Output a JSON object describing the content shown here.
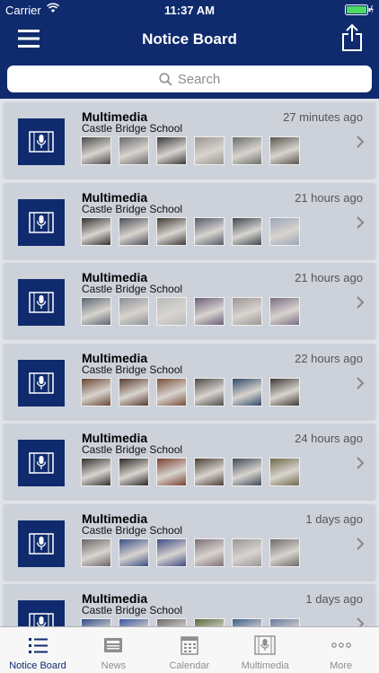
{
  "status": {
    "carrier": "Carrier",
    "time": "11:37 AM"
  },
  "nav": {
    "title": "Notice Board"
  },
  "search": {
    "placeholder": "Search"
  },
  "notices": [
    {
      "title": "Multimedia",
      "subtitle": "Castle Bridge School",
      "time": "27 minutes ago",
      "thumbs": [
        "#4a4a4a",
        "#6a6a6a",
        "#3a3a3a",
        "#9a9590",
        "#6b6f6a",
        "#5b554e"
      ]
    },
    {
      "title": "Multimedia",
      "subtitle": "Castle Bridge School",
      "time": "21 hours ago",
      "thumbs": [
        "#333030",
        "#4c4f5a",
        "#3f3a36",
        "#525a6b",
        "#3f4752",
        "#9aa5b8"
      ]
    },
    {
      "title": "Multimedia",
      "subtitle": "Castle Bridge School",
      "time": "21 hours ago",
      "thumbs": [
        "#5c6672",
        "#8b9096",
        "#b7bbb9",
        "#6a5f79",
        "#9c9694",
        "#7a6d84"
      ]
    },
    {
      "title": "Multimedia",
      "subtitle": "Castle Bridge School",
      "time": "22 hours ago",
      "thumbs": [
        "#6b4533",
        "#5a3a2e",
        "#7a4e3b",
        "#4e4a48",
        "#2f4a6a",
        "#403a37"
      ]
    },
    {
      "title": "Multimedia",
      "subtitle": "Castle Bridge School",
      "time": "24 hours ago",
      "thumbs": [
        "#33302c",
        "#2c2926",
        "#7a3f2f",
        "#4b3f35",
        "#3d4a57",
        "#6f6a49"
      ]
    },
    {
      "title": "Multimedia",
      "subtitle": "Castle Bridge School",
      "time": "1 days ago",
      "thumbs": [
        "#6a6565",
        "#3b4f88",
        "#3e4a86",
        "#7d6f78",
        "#9a9696",
        "#6e6c69"
      ]
    },
    {
      "title": "Multimedia",
      "subtitle": "Castle Bridge School",
      "time": "1 days ago",
      "thumbs": [
        "#2f4a8a",
        "#3a55a0",
        "#6a6a6a",
        "#5a6a3a",
        "#3b5f8a",
        "#6a7aa0"
      ]
    }
  ],
  "tabs": [
    {
      "label": "Notice Board",
      "icon": "list-icon",
      "active": true
    },
    {
      "label": "News",
      "icon": "newspaper-icon",
      "active": false
    },
    {
      "label": "Calendar",
      "icon": "calendar-icon",
      "active": false
    },
    {
      "label": "Multimedia",
      "icon": "multimedia-icon",
      "active": false
    },
    {
      "label": "More",
      "icon": "more-icon",
      "active": false
    }
  ],
  "colors": {
    "brand": "#0f2b6e",
    "card": "#cdd1da",
    "background": "#dfe3ea"
  }
}
